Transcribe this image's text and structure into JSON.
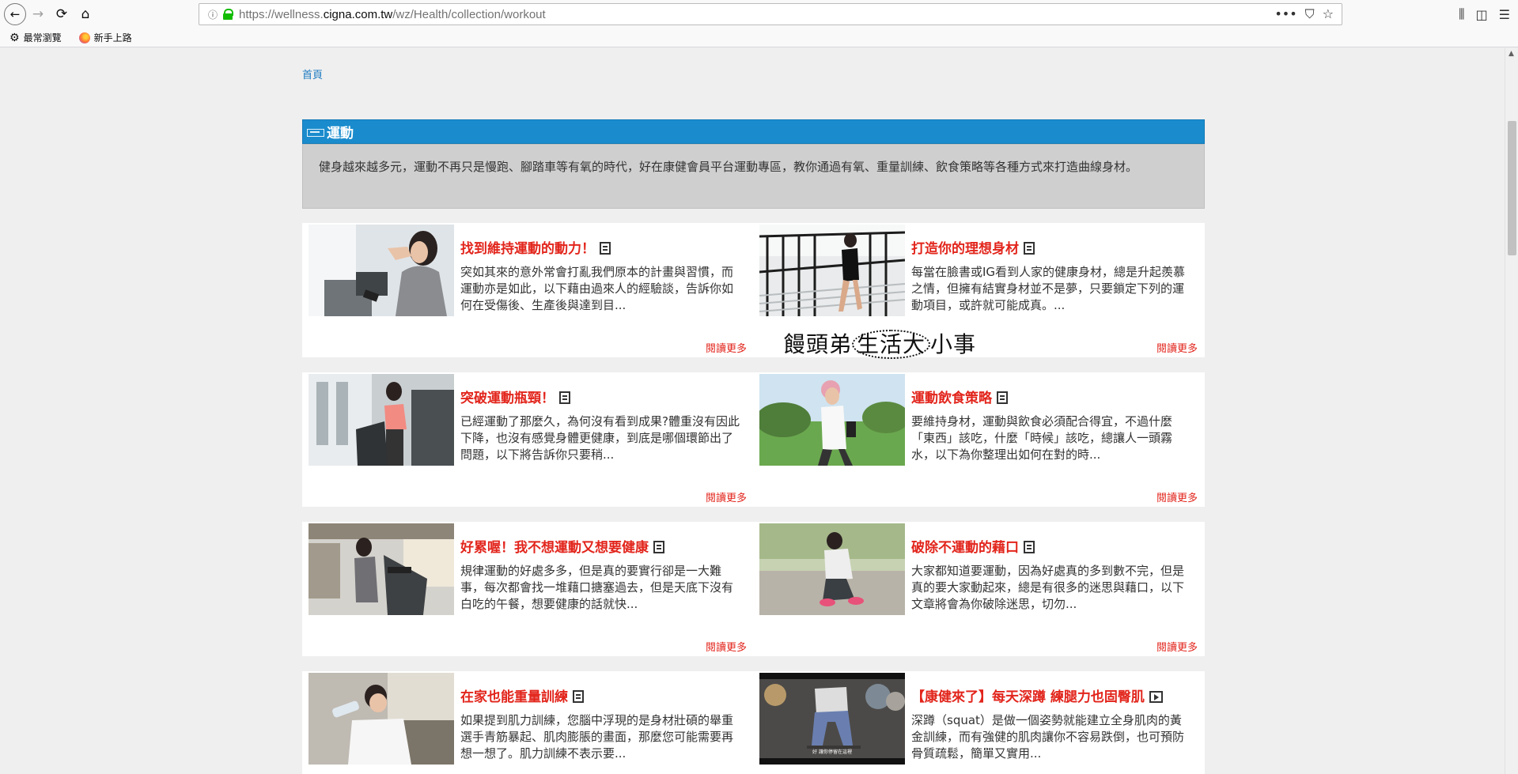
{
  "browser": {
    "url_prefix": "https://wellness.",
    "url_domain": "cigna.com.tw",
    "url_path": "/wz/Health/collection/workout",
    "bookmarks": [
      "最常瀏覽",
      "新手上路"
    ]
  },
  "page": {
    "breadcrumb": "首頁",
    "section_title": "運動",
    "intro": "健身越來越多元，運動不再只是慢跑、腳踏車等有氧的時代，好在康健會員平台運動專區，教你通過有氧、重量訓練、飲食策略等各種方式來打造曲線身材。",
    "watermark": {
      "pre": "饅頭弟",
      "mid": "生活大",
      "post": "小事"
    },
    "read_more": "閱讀更多",
    "articles": [
      {
        "title": "找到維持運動的動力！",
        "desc": "突如其來的意外常會打亂我們原本的計畫與習慣，而運動亦是如此，以下藉由過來人的經驗談，告訴你如何在受傷後、生產後與達到目...",
        "type": "article"
      },
      {
        "title": "打造你的理想身材",
        "desc": "每當在臉書或IG看到人家的健康身材，總是升起羨慕之情，但擁有結實身材並不是夢，只要鎖定下列的運動項目，或許就可能成真。...",
        "type": "article"
      },
      {
        "title": "突破運動瓶頸！",
        "desc": "已經運動了那麼久，為何沒有看到成果?體重沒有因此下降，也沒有感覺身體更健康，到底是哪個環節出了問題，以下將告訴你只要稍...",
        "type": "article"
      },
      {
        "title": "運動飲食策略",
        "desc": "要維持身材，運動與飲食必須配合得宜，不過什麼「東西」該吃，什麼「時候」該吃，總讓人一頭霧水，以下為你整理出如何在對的時...",
        "type": "article"
      },
      {
        "title": "好累喔！我不想運動又想要健康",
        "desc": "規律運動的好處多多，但是真的要實行卻是一大難事，每次都會找一堆藉口搪塞過去，但是天底下沒有白吃的午餐，想要健康的話就快...",
        "type": "article"
      },
      {
        "title": "破除不運動的藉口",
        "desc": "大家都知道要運動，因為好處真的多到數不完，但是真的要大家動起來，總是有很多的迷思與藉口，以下文章將會為你破除迷思，切勿...",
        "type": "article"
      },
      {
        "title": "在家也能重量訓練",
        "desc": "如果提到肌力訓練，您腦中浮現的是身材壯碩的舉重選手青筋暴起、肌肉膨脹的畫面，那麼您可能需要再想一想了。肌力訓練不表示要...",
        "type": "article"
      },
      {
        "title": "【康健來了】每天深蹲 練腿力也固臀肌",
        "desc": "深蹲（squat）是做一個姿勢就能建立全身肌肉的黃金訓練，而有強健的肌肉讓你不容易跌倒，也可預防骨質疏鬆，簡單又實用...",
        "type": "video",
        "caption": "好 讓你停留在這裡"
      }
    ]
  }
}
